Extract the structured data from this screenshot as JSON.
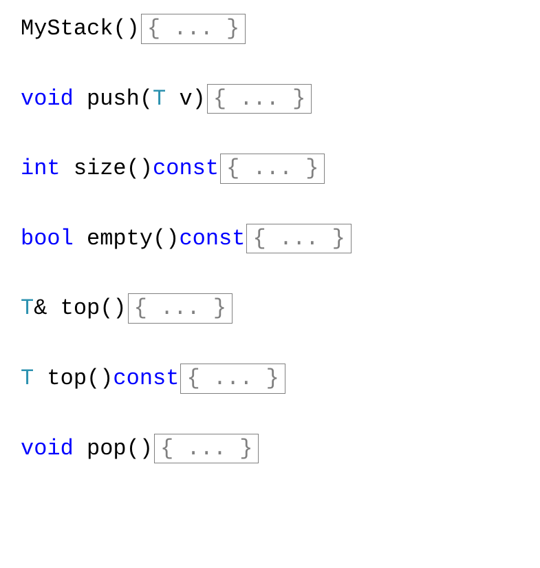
{
  "lines": [
    {
      "segments": [
        {
          "text": "MyStack",
          "class": "identifier"
        },
        {
          "text": "()",
          "class": "punct"
        }
      ],
      "fold": "{ ... }"
    },
    {
      "segments": [
        {
          "text": "void",
          "class": "keyword"
        },
        {
          "text": " push(",
          "class": "identifier"
        },
        {
          "text": "T",
          "class": "type"
        },
        {
          "text": " v)",
          "class": "identifier"
        }
      ],
      "fold": "{ ... }"
    },
    {
      "segments": [
        {
          "text": "int",
          "class": "keyword"
        },
        {
          "text": " size()",
          "class": "identifier"
        },
        {
          "text": "const",
          "class": "keyword"
        }
      ],
      "fold": "{ ... }"
    },
    {
      "segments": [
        {
          "text": "bool",
          "class": "keyword"
        },
        {
          "text": " empty()",
          "class": "identifier"
        },
        {
          "text": "const",
          "class": "keyword"
        }
      ],
      "fold": "{ ... }"
    },
    {
      "segments": [
        {
          "text": "T",
          "class": "type"
        },
        {
          "text": "& top()",
          "class": "identifier"
        }
      ],
      "fold": "{ ... }"
    },
    {
      "segments": [
        {
          "text": "T",
          "class": "type"
        },
        {
          "text": " top()",
          "class": "identifier"
        },
        {
          "text": "const",
          "class": "keyword"
        }
      ],
      "fold": "{ ... }"
    },
    {
      "segments": [
        {
          "text": "void",
          "class": "keyword"
        },
        {
          "text": " pop()",
          "class": "identifier"
        }
      ],
      "fold": "{ ... }"
    }
  ]
}
